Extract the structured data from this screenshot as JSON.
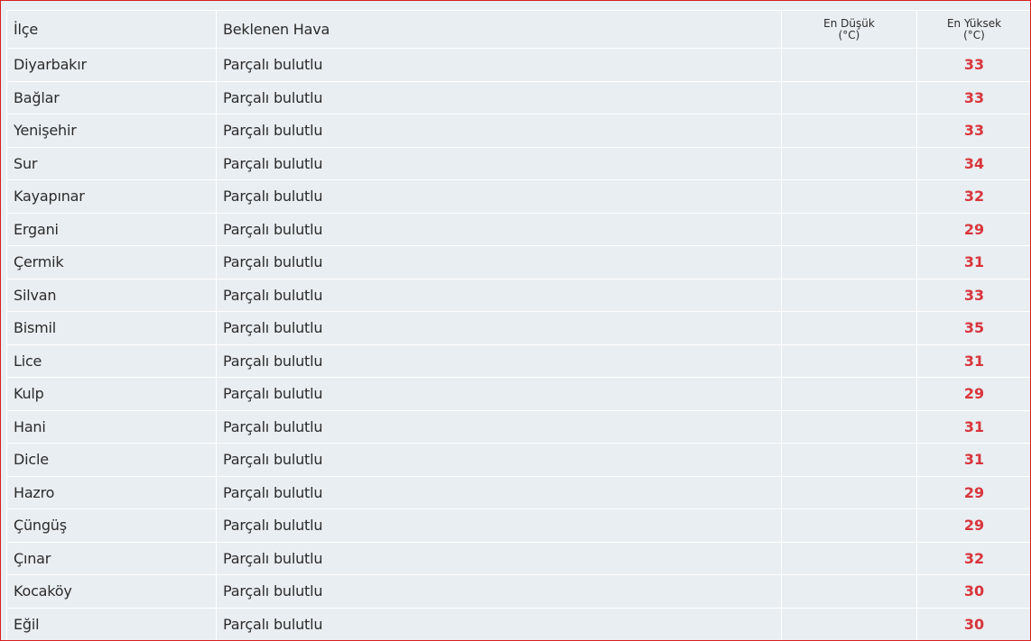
{
  "colors": {
    "border": "#d9201f",
    "row_background": "#e9eef2",
    "max_temp": "#d8353c"
  },
  "table": {
    "headers": {
      "district": "İlçe",
      "expected_weather": "Beklenen Hava",
      "min_temp_line1": "En Düşük",
      "min_temp_line2": "(°C)",
      "max_temp_line1": "En Yüksek",
      "max_temp_line2": "(°C)"
    },
    "rows": [
      {
        "district": "Diyarbakır",
        "weather": "Parçalı bulutlu",
        "min": "",
        "max": "33"
      },
      {
        "district": "Bağlar",
        "weather": "Parçalı bulutlu",
        "min": "",
        "max": "33"
      },
      {
        "district": "Yenişehir",
        "weather": "Parçalı bulutlu",
        "min": "",
        "max": "33"
      },
      {
        "district": "Sur",
        "weather": "Parçalı bulutlu",
        "min": "",
        "max": "34"
      },
      {
        "district": "Kayapınar",
        "weather": "Parçalı bulutlu",
        "min": "",
        "max": "32"
      },
      {
        "district": "Ergani",
        "weather": "Parçalı bulutlu",
        "min": "",
        "max": "29"
      },
      {
        "district": "Çermik",
        "weather": "Parçalı bulutlu",
        "min": "",
        "max": "31"
      },
      {
        "district": "Silvan",
        "weather": "Parçalı bulutlu",
        "min": "",
        "max": "33"
      },
      {
        "district": "Bismil",
        "weather": "Parçalı bulutlu",
        "min": "",
        "max": "35"
      },
      {
        "district": "Lice",
        "weather": "Parçalı bulutlu",
        "min": "",
        "max": "31"
      },
      {
        "district": "Kulp",
        "weather": "Parçalı bulutlu",
        "min": "",
        "max": "29"
      },
      {
        "district": "Hani",
        "weather": "Parçalı bulutlu",
        "min": "",
        "max": "31"
      },
      {
        "district": "Dicle",
        "weather": "Parçalı bulutlu",
        "min": "",
        "max": "31"
      },
      {
        "district": "Hazro",
        "weather": "Parçalı bulutlu",
        "min": "",
        "max": "29"
      },
      {
        "district": "Çüngüş",
        "weather": "Parçalı bulutlu",
        "min": "",
        "max": "29"
      },
      {
        "district": "Çınar",
        "weather": "Parçalı bulutlu",
        "min": "",
        "max": "32"
      },
      {
        "district": "Kocaköy",
        "weather": "Parçalı bulutlu",
        "min": "",
        "max": "30"
      },
      {
        "district": "Eğil",
        "weather": "Parçalı bulutlu",
        "min": "",
        "max": "30"
      }
    ]
  }
}
